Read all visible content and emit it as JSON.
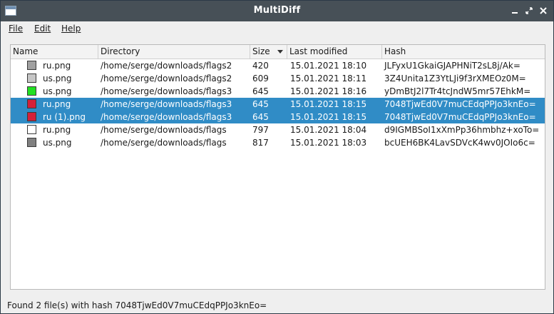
{
  "window": {
    "title": "MultiDiff"
  },
  "menu": [
    {
      "label": "File"
    },
    {
      "label": "Edit"
    },
    {
      "label": "Help"
    }
  ],
  "table": {
    "columns": [
      "Name",
      "Directory",
      "Size",
      "Last modified",
      "Hash"
    ],
    "sorted_column": "Size",
    "rows": [
      {
        "name": "ru.png",
        "swatch": "#a0a0a0",
        "directory": "/home/serge/downloads/flags2",
        "size": "420",
        "modified": "15.01.2021 18:10",
        "hash": "JLFyxU1GkaiGJAPHNiT2sL8j/Ak=",
        "selected": false
      },
      {
        "name": "us.png",
        "swatch": "#c6c6c6",
        "directory": "/home/serge/downloads/flags2",
        "size": "609",
        "modified": "15.01.2021 18:11",
        "hash": "3Z4Unita1Z3YtLJi9f3rXMEOz0M=",
        "selected": false
      },
      {
        "name": "us.png",
        "swatch": "#22e022",
        "directory": "/home/serge/downloads/flags3",
        "size": "645",
        "modified": "15.01.2021 18:16",
        "hash": "yDmBtJ2l7Tr4tcJndW5mr57EhkM=",
        "selected": false
      },
      {
        "name": "ru.png",
        "swatch": "#d4203a",
        "directory": "/home/serge/downloads/flags3",
        "size": "645",
        "modified": "15.01.2021 18:15",
        "hash": "7048TjwEd0V7muCEdqPPJo3knEo=",
        "selected": true
      },
      {
        "name": "ru (1).png",
        "swatch": "#d4203a",
        "directory": "/home/serge/downloads/flags3",
        "size": "645",
        "modified": "15.01.2021 18:15",
        "hash": "7048TjwEd0V7muCEdqPPJo3knEo=",
        "selected": true
      },
      {
        "name": "ru.png",
        "swatch": "#ffffff",
        "directory": "/home/serge/downloads/flags",
        "size": "797",
        "modified": "15.01.2021 18:04",
        "hash": "d9IGMBSoI1xXmPp36hmbhz+xoTo=",
        "selected": false
      },
      {
        "name": "us.png",
        "swatch": "#808080",
        "directory": "/home/serge/downloads/flags",
        "size": "817",
        "modified": "15.01.2021 18:03",
        "hash": "bcUEH6BK4LavSDVcK4wv0JOIo6c=",
        "selected": false
      }
    ]
  },
  "status": {
    "text": "Found 2 file(s) with hash 7048TjwEd0V7muCEdqPPJo3knEo="
  },
  "colors": {
    "titlebar": "#475057",
    "selection": "#308cc6"
  }
}
